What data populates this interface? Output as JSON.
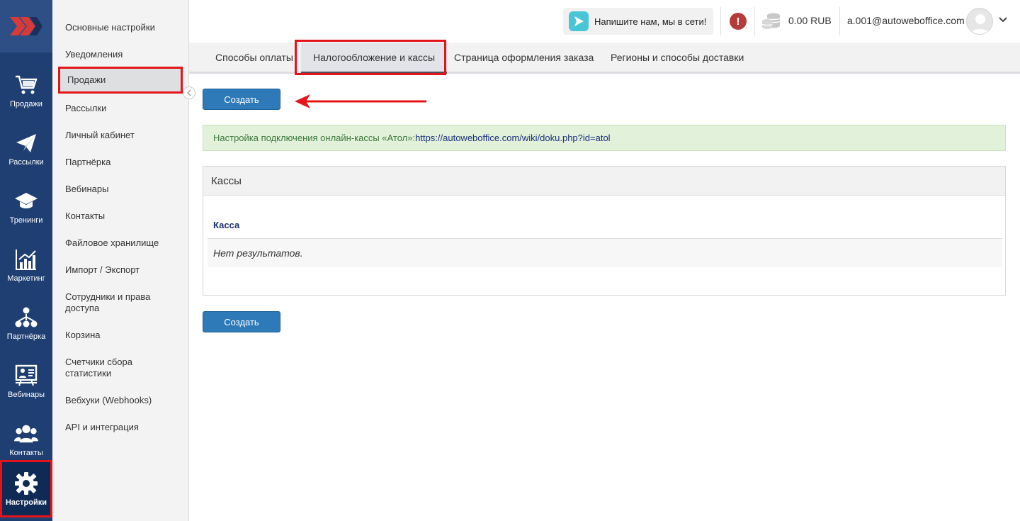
{
  "rail": {
    "items": [
      {
        "label": "Продажи",
        "icon": "cart-icon"
      },
      {
        "label": "Рассылки",
        "icon": "paper-plane-icon"
      },
      {
        "label": "Тренинги",
        "icon": "graduation-cap-icon"
      },
      {
        "label": "Маркетинг",
        "icon": "bar-chart-icon"
      },
      {
        "label": "Партнёрка",
        "icon": "network-icon"
      },
      {
        "label": "Вебинары",
        "icon": "presentation-icon"
      },
      {
        "label": "Контакты",
        "icon": "users-icon"
      },
      {
        "label": "Настройки",
        "icon": "gear-icon"
      }
    ],
    "active": "Настройки",
    "accent_color": "#1f3f72"
  },
  "submenu": {
    "items": [
      "Основные настройки",
      "Уведомления",
      "Продажи",
      "Рассылки",
      "Личный кабинет",
      "Партнёрка",
      "Вебинары",
      "Контакты",
      "Файловое хранилище",
      "Импорт / Экспорт",
      "Сотрудники и права доступа",
      "Корзина",
      "Счетчики сбора статистики",
      "Вебхуки (Webhooks)",
      "API и интеграция"
    ],
    "selected": "Продажи"
  },
  "header": {
    "chat_label": "Напишите нам, мы в сети!",
    "balance": "0.00 RUB",
    "user_email": "a.001@autoweboffice.com"
  },
  "tabs": {
    "items": [
      {
        "label": "Способы оплаты"
      },
      {
        "label": "Налогообложение и кассы"
      },
      {
        "label": "Страница оформления заказа"
      },
      {
        "label": "Регионы и способы доставки"
      }
    ],
    "active": "Налогообложение и кассы"
  },
  "content": {
    "create_label": "Создать",
    "info_text": "Настройка подключения онлайн-кассы «Атол»: ",
    "info_link": "https://autoweboffice.com/wiki/doku.php?id=atol",
    "panel_title": "Кассы",
    "column_header": "Касса",
    "empty_text": "Нет результатов."
  },
  "colors": {
    "highlight": "#e3151a",
    "primary_button": "#2e7ab8",
    "info_bg": "#e2f2da"
  }
}
